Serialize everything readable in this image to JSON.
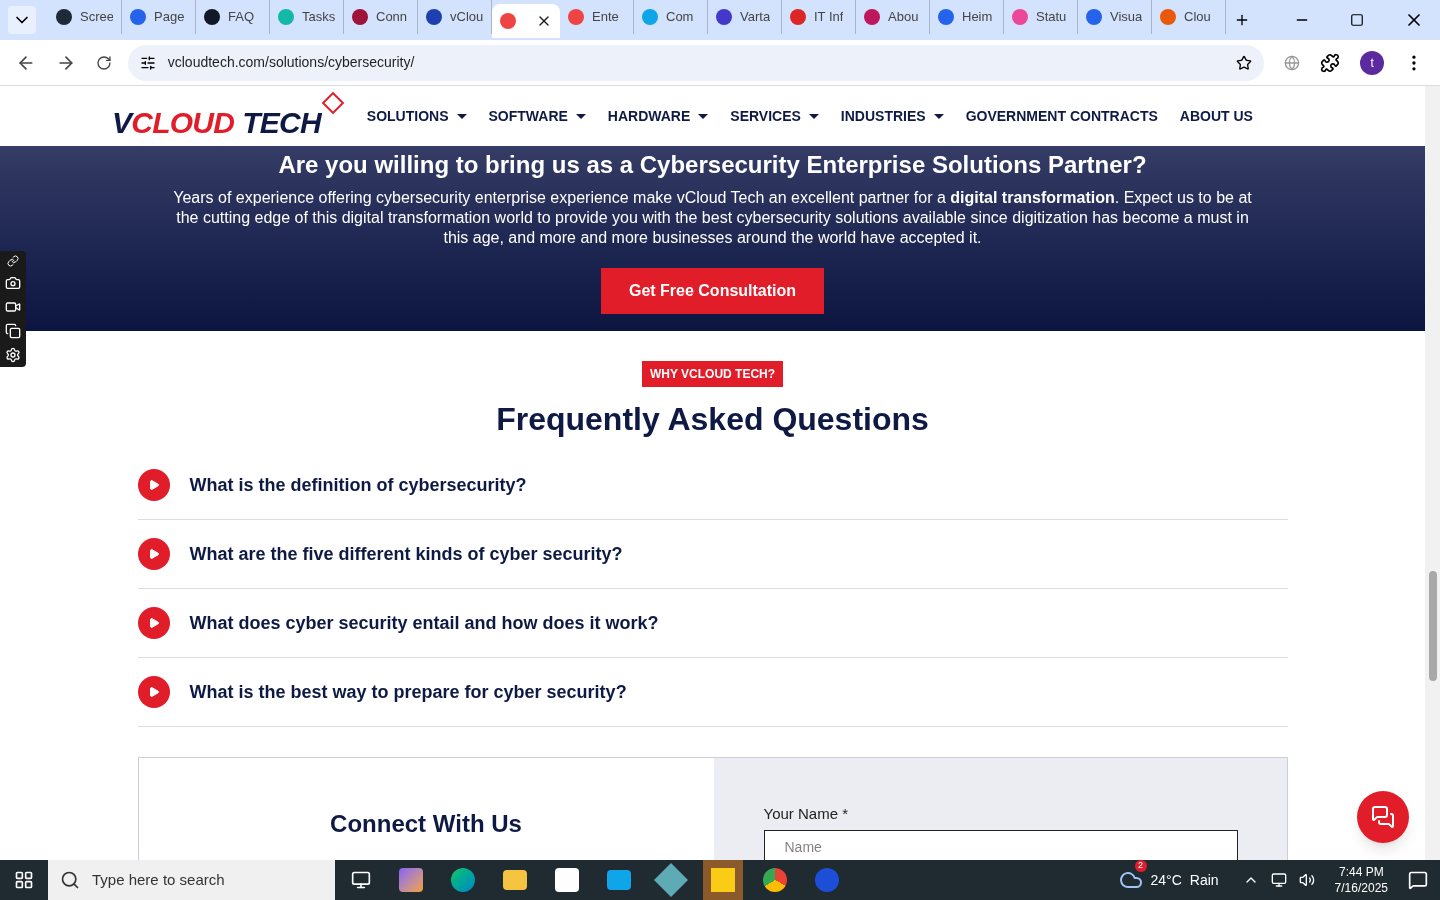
{
  "browser": {
    "tabs": [
      {
        "title": "Scree",
        "selected": false
      },
      {
        "title": "Page",
        "selected": false
      },
      {
        "title": "FAQ",
        "selected": false
      },
      {
        "title": "Tasks",
        "selected": false
      },
      {
        "title": "Conn",
        "selected": false
      },
      {
        "title": "vClou",
        "selected": false
      },
      {
        "selected": true
      },
      {
        "title": "Ente",
        "selected": false
      },
      {
        "title": "Com",
        "selected": false
      },
      {
        "title": "Varta",
        "selected": false
      },
      {
        "title": "IT Inf",
        "selected": false
      },
      {
        "title": "Abou",
        "selected": false
      },
      {
        "title": "Heim",
        "selected": false
      },
      {
        "title": "Statu",
        "selected": false
      },
      {
        "title": "Visua",
        "selected": false
      },
      {
        "title": "Clou",
        "selected": false
      }
    ],
    "address": "vcloudtech.com/solutions/cybersecurity/",
    "profile_initial": "t"
  },
  "site": {
    "logo": {
      "part_1": "V",
      "part_2": "CLOUD",
      "part_3": "TECH"
    },
    "nav": [
      {
        "label": "SOLUTIONS",
        "dropdown": true
      },
      {
        "label": "SOFTWARE",
        "dropdown": true
      },
      {
        "label": "HARDWARE",
        "dropdown": true
      },
      {
        "label": "SERVICES",
        "dropdown": true
      },
      {
        "label": "INDUSTRIES",
        "dropdown": true
      },
      {
        "label": "GOVERNMENT CONTRACTS",
        "dropdown": false
      },
      {
        "label": "ABOUT US",
        "dropdown": false
      }
    ],
    "banner": {
      "heading": "Are you willing to bring us as a Cybersecurity Enterprise Solutions Partner?",
      "text": "Years of experience offering cybersecurity enterprise experience make vCloud Tech an excellent partner for a **digital transformation**. Expect us to be at the cutting edge of this digital transformation world to provide you with the best cybersecurity solutions available since digitization has become a must in this age, and more and more businesses around the world have accepted it.",
      "button": "Get Free Consultation"
    },
    "faq": {
      "badge": "WHY VCLOUD TECH?",
      "title": "Frequently Asked Questions",
      "items": [
        {
          "question": "What is the definition of cybersecurity?",
          "expanded": false
        },
        {
          "question": "What are the five different kinds of cyber security?",
          "expanded": false
        },
        {
          "question": "What does cyber security entail and how does it work?",
          "expanded": false
        },
        {
          "question": "What is the best way to prepare for cyber security?",
          "expanded": false
        }
      ]
    },
    "contact": {
      "title": "Connect With Us",
      "name_label": "Your Name *",
      "name_placeholder": "Name"
    }
  },
  "taskbar": {
    "search_placeholder": "Type here to search",
    "weather": {
      "badge": "2",
      "temp": "24°C",
      "condition": "Rain"
    },
    "time": "7:44 PM",
    "date": "7/16/2025"
  }
}
